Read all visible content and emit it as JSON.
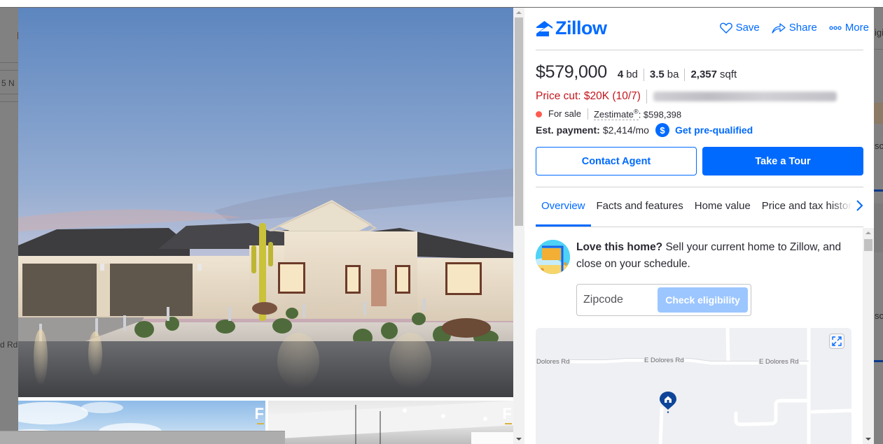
{
  "background_page": {
    "left_snippets": [
      "5 N",
      "d Rd"
    ],
    "right_snippets": [
      "igi",
      "sc",
      "sc"
    ]
  },
  "header": {
    "brand": "Zillow",
    "actions": [
      {
        "label": "Save",
        "icon": "heart-icon"
      },
      {
        "label": "Share",
        "icon": "share-icon"
      },
      {
        "label": "More",
        "icon": "more-dots-icon"
      }
    ]
  },
  "listing": {
    "price": "$579,000",
    "beds": {
      "value": "4",
      "unit": "bd"
    },
    "baths": {
      "value": "3.5",
      "unit": "ba"
    },
    "sqft": {
      "value": "2,357",
      "unit": "sqft"
    },
    "price_cut": "Price cut: $20K (10/7)",
    "status": "For sale",
    "status_color": "#ff5a50",
    "zestimate_label": "Zestimate",
    "zestimate_mark": "®",
    "zestimate_value": ": $598,398",
    "est_payment_label": "Est. payment:",
    "est_payment_value": "$2,414/mo",
    "prequal_label": "Get pre-qualified"
  },
  "buttons": {
    "contact": "Contact Agent",
    "tour": "Take a Tour"
  },
  "tabs": [
    {
      "label": "Overview",
      "active": true
    },
    {
      "label": "Facts and features",
      "active": false
    },
    {
      "label": "Home value",
      "active": false
    },
    {
      "label": "Price and tax history",
      "active": false
    }
  ],
  "promo": {
    "bold": "Love this home?",
    "text": " Sell your current home to Zillow, and close on your schedule.",
    "zip_placeholder": "Zipcode",
    "check_label": "Check eligibility"
  },
  "map": {
    "road_labels": [
      "Dolores Rd",
      "E Dolores Rd",
      "E Dolores Rd"
    ]
  },
  "colors": {
    "brand_blue": "#006aff",
    "price_cut_red": "#c4151c",
    "pin_navy": "#0d4599"
  }
}
